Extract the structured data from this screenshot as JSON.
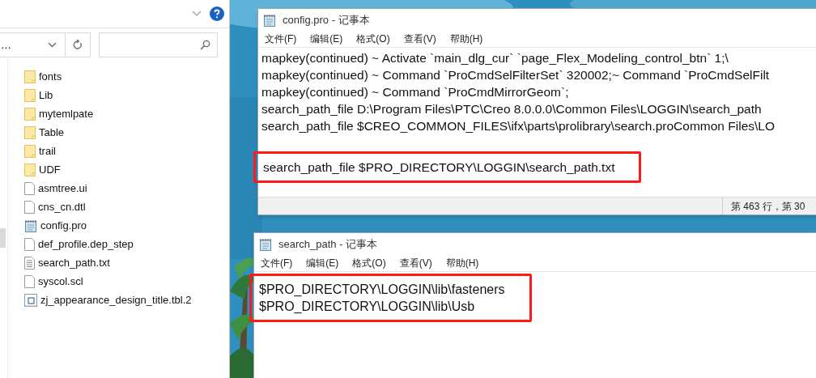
{
  "explorer": {
    "address": "…",
    "items": [
      {
        "kind": "folder",
        "name": "fonts"
      },
      {
        "kind": "folder",
        "name": "Lib"
      },
      {
        "kind": "folder",
        "name": "mytemlpate"
      },
      {
        "kind": "folder",
        "name": "Table"
      },
      {
        "kind": "folder",
        "name": "trail"
      },
      {
        "kind": "folder",
        "name": "UDF"
      },
      {
        "kind": "file",
        "name": "asmtree.ui"
      },
      {
        "kind": "file",
        "name": "cns_cn.dtl"
      },
      {
        "kind": "notepad",
        "name": "config.pro"
      },
      {
        "kind": "file",
        "name": "def_profile.dep_step"
      },
      {
        "kind": "text",
        "name": "search_path.txt"
      },
      {
        "kind": "file",
        "name": "syscol.scl"
      },
      {
        "kind": "table",
        "name": "zj_appearance_design_title.tbl.2"
      }
    ]
  },
  "windows": [
    {
      "title": "config.pro - 记事本",
      "menu": [
        "文件(F)",
        "编辑(E)",
        "格式(O)",
        "查看(V)",
        "帮助(H)"
      ],
      "blocks": [
        {
          "highlighted": false,
          "lines": [
            "mapkey(continued) ~ Activate `main_dlg_cur` `page_Flex_Modeling_control_btn` 1;\\",
            "mapkey(continued) ~ Command `ProCmdSelFilterSet` 320002;~ Command `ProCmdSelFilt",
            "mapkey(continued) ~ Command `ProCmdMirrorGeom`;",
            "search_path_file D:\\Program Files\\PTC\\Creo 8.0.0.0\\Common Files\\LOGGIN\\search_path",
            "search_path_file $CREO_COMMON_FILES\\ifx\\parts\\prolibrary\\search.proCommon Files\\LO"
          ]
        },
        {
          "highlighted": true,
          "lines": [
            "search_path_file $PRO_DIRECTORY\\LOGGIN\\search_path.txt"
          ]
        }
      ],
      "status": "第 463 行，第 30"
    },
    {
      "title": "search_path - 记事本",
      "menu": [
        "文件(F)",
        "编辑(E)",
        "格式(O)",
        "查看(V)",
        "帮助(H)"
      ],
      "blocks": [
        {
          "highlighted": true,
          "lines": [
            "$PRO_DIRECTORY\\LOGGIN\\lib\\fasteners",
            "$PRO_DIRECTORY\\LOGGIN\\lib\\Usb"
          ]
        }
      ]
    }
  ]
}
